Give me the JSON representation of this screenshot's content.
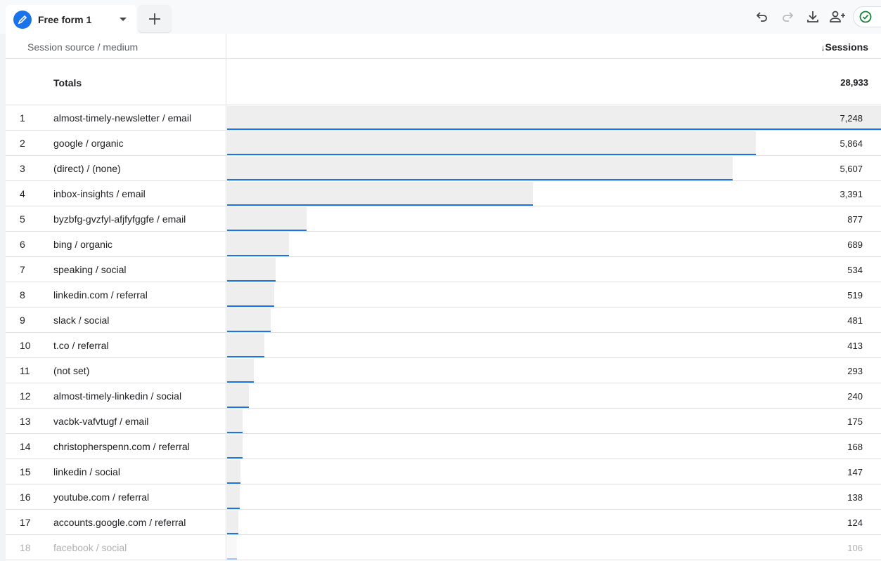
{
  "tab": {
    "label": "Free form 1",
    "icon": "pencil-icon"
  },
  "toolbar": {
    "icons": [
      "undo-icon",
      "redo-icon",
      "download-icon",
      "share-icon",
      "check-circle-icon"
    ]
  },
  "colors": {
    "accent": "#1a73e8",
    "bar": "#eeeeee",
    "check": "#188038"
  },
  "table": {
    "dimension_header": "Session source / medium",
    "metric_header": "Sessions",
    "sort_indicator": "↓",
    "totals_label": "Totals",
    "totals_value": "28,933",
    "rows": [
      {
        "n": "1",
        "dim": "almost-timely-newsletter / email",
        "value": "7,248",
        "num": 7248
      },
      {
        "n": "2",
        "dim": "google / organic",
        "value": "5,864",
        "num": 5864
      },
      {
        "n": "3",
        "dim": "(direct) / (none)",
        "value": "5,607",
        "num": 5607
      },
      {
        "n": "4",
        "dim": "inbox-insights / email",
        "value": "3,391",
        "num": 3391
      },
      {
        "n": "5",
        "dim": "byzbfg-gvzfyl-afjfyfggfe / email",
        "value": "877",
        "num": 877
      },
      {
        "n": "6",
        "dim": "bing / organic",
        "value": "689",
        "num": 689
      },
      {
        "n": "7",
        "dim": "speaking / social",
        "value": "534",
        "num": 534
      },
      {
        "n": "8",
        "dim": "linkedin.com / referral",
        "value": "519",
        "num": 519
      },
      {
        "n": "9",
        "dim": "slack / social",
        "value": "481",
        "num": 481
      },
      {
        "n": "10",
        "dim": "t.co / referral",
        "value": "413",
        "num": 413
      },
      {
        "n": "11",
        "dim": "(not set)",
        "value": "293",
        "num": 293
      },
      {
        "n": "12",
        "dim": "almost-timely-linkedin / social",
        "value": "240",
        "num": 240
      },
      {
        "n": "13",
        "dim": "vacbk-vafvtugf / email",
        "value": "175",
        "num": 175
      },
      {
        "n": "14",
        "dim": "christopherspenn.com / referral",
        "value": "168",
        "num": 168
      },
      {
        "n": "15",
        "dim": "linkedin / social",
        "value": "147",
        "num": 147
      },
      {
        "n": "16",
        "dim": "youtube.com / referral",
        "value": "138",
        "num": 138
      },
      {
        "n": "17",
        "dim": "accounts.google.com / referral",
        "value": "124",
        "num": 124
      },
      {
        "n": "18",
        "dim": "facebook / social",
        "value": "106",
        "num": 106
      }
    ]
  }
}
